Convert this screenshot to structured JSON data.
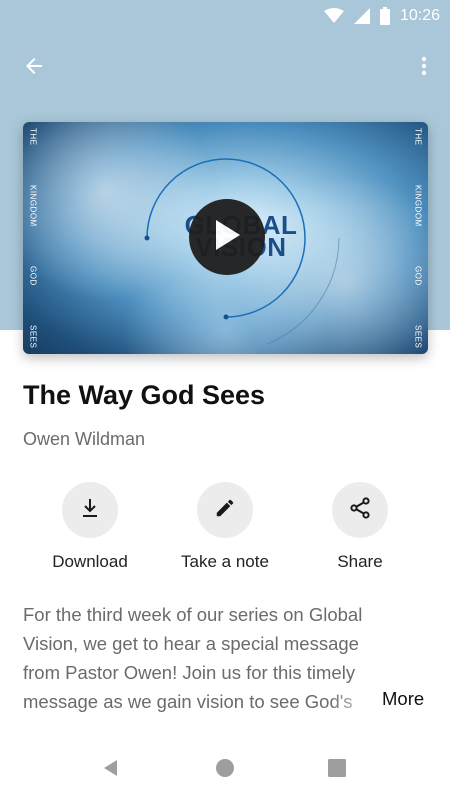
{
  "status_bar": {
    "time": "10:26",
    "icons": [
      "wifi-icon",
      "cell-signal-icon",
      "battery-icon"
    ]
  },
  "app_bar": {
    "back_icon": "arrow-left-icon",
    "menu_icon": "more-vert-icon"
  },
  "video": {
    "logo_line1": "GLOBAL",
    "logo_line2": "VISION",
    "side_left": [
      "THE",
      "KINGDOM",
      "GOD",
      "SEES"
    ],
    "side_right": [
      "THE",
      "KINGDOM",
      "GOD",
      "SEES"
    ],
    "play_icon": "play-icon"
  },
  "title": "The Way God Sees",
  "author": "Owen Wildman",
  "actions": [
    {
      "label": "Download",
      "icon": "download-icon"
    },
    {
      "label": "Take a note",
      "icon": "pencil-icon"
    },
    {
      "label": "Share",
      "icon": "share-icon"
    }
  ],
  "description": "For the third week of our series on Global Vision, we get to hear a special message from Pastor Owen! Join us for this timely message as we gain vision to see God's",
  "more_label": "More",
  "colors": {
    "header_bg": "#a9c7d8",
    "logo_blue": "#1a4f8a",
    "action_circle": "#ececec"
  }
}
